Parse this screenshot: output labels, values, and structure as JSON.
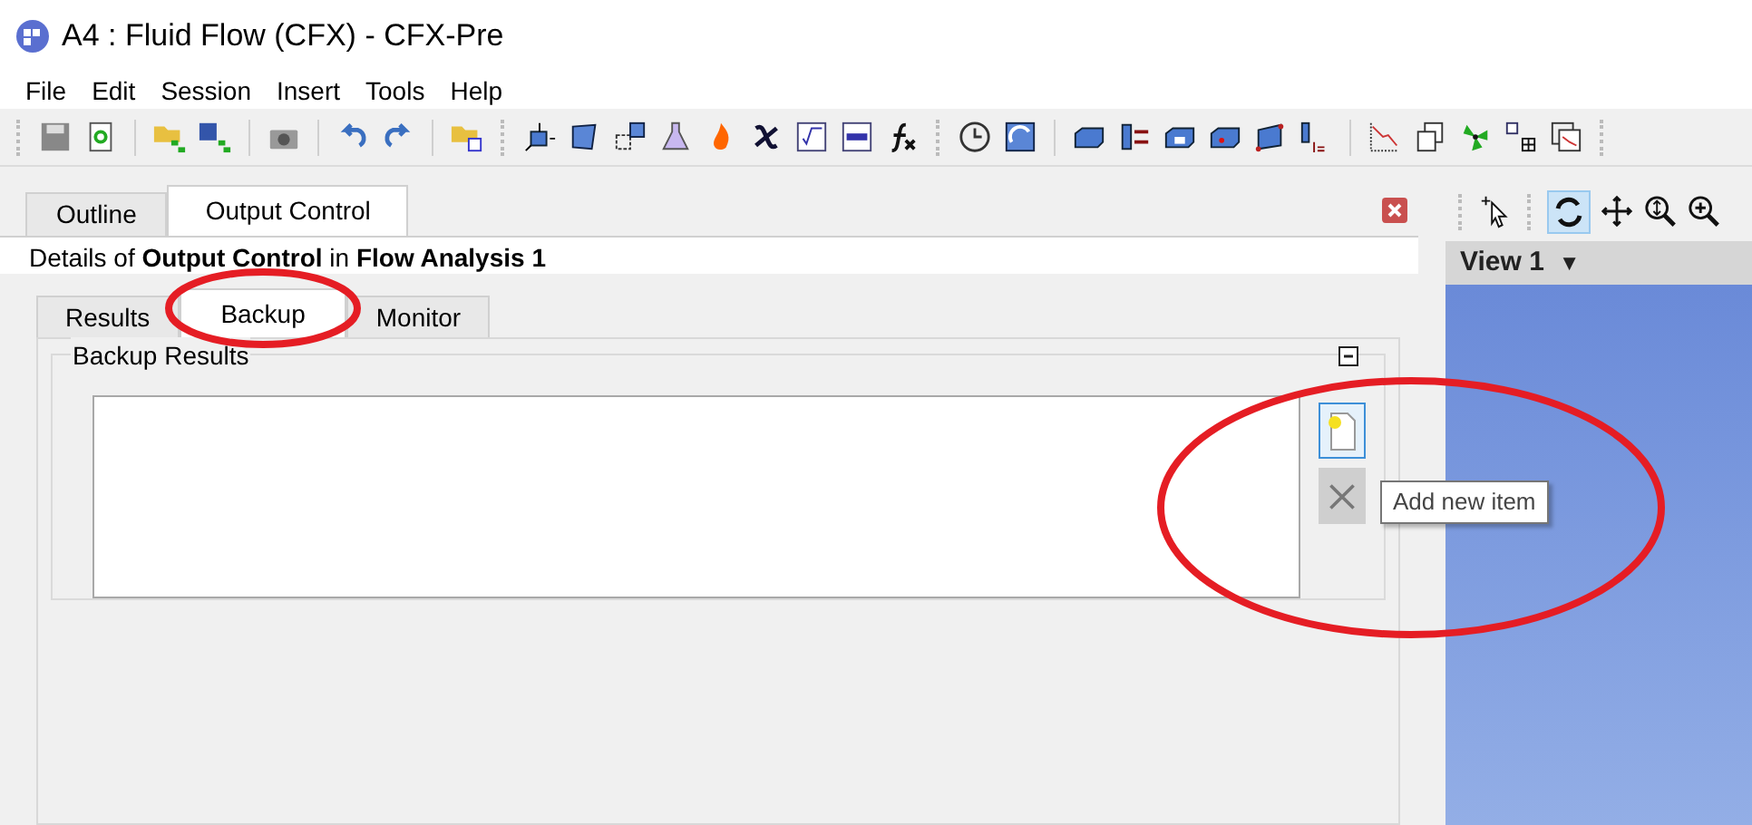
{
  "window": {
    "title": "A4 : Fluid Flow (CFX) - CFX-Pre"
  },
  "menu": [
    "File",
    "Edit",
    "Session",
    "Insert",
    "Tools",
    "Help"
  ],
  "panel_tabs": [
    {
      "label": "Outline",
      "selected": false
    },
    {
      "label": "Output Control",
      "selected": true
    }
  ],
  "details": "Details of **Output Control** in **Flow Analysis 1**",
  "detail_tabs": [
    {
      "label": "Results",
      "selected": false
    },
    {
      "label": "Backup",
      "selected": true
    },
    {
      "label": "Monitor",
      "selected": false
    }
  ],
  "group": {
    "title": "Backup Results",
    "expanded": true
  },
  "list_buttons": [
    {
      "kind": "add",
      "disabled": false,
      "hovered": true
    },
    {
      "kind": "delete",
      "disabled": true,
      "hovered": false
    }
  ],
  "tooltip": "Add new item",
  "viewport": {
    "title": "View 1",
    "dropdown": "▼"
  }
}
